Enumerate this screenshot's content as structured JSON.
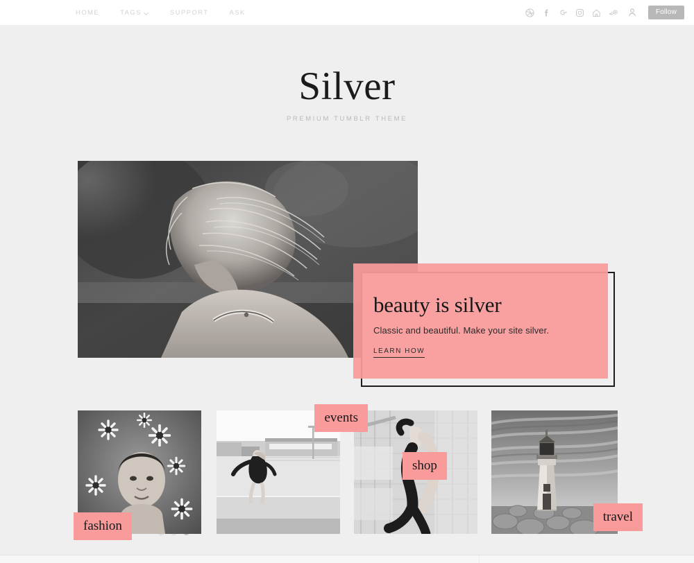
{
  "nav": {
    "items": [
      {
        "label": "HOME",
        "has_dropdown": false
      },
      {
        "label": "TAGS",
        "has_dropdown": true
      },
      {
        "label": "SUPPORT",
        "has_dropdown": false
      },
      {
        "label": "ASK",
        "has_dropdown": false
      }
    ],
    "social_icons": [
      "dribbble-icon",
      "facebook-icon",
      "google-plus-icon",
      "instagram-icon",
      "pinterest-icon",
      "twitter-icon"
    ],
    "account_icon": "user-avatar-icon",
    "follow_label": "Follow"
  },
  "header": {
    "title": "Silver",
    "subtitle": "PREMIUM TUMBLR THEME"
  },
  "hero": {
    "photo_alt": "black-and-white photo of woman with windswept hair",
    "heading": "beauty is silver",
    "subtext": "Classic and beautiful. Make your site silver.",
    "cta_label": "LEARN HOW",
    "dots": [
      {
        "active": false
      },
      {
        "active": false
      },
      {
        "active": true
      }
    ]
  },
  "categories": [
    {
      "label": "fashion",
      "photo_alt": "woman surrounded by daisies in water"
    },
    {
      "label": "events",
      "photo_alt": "woman dancing on an empty boardwalk"
    },
    {
      "label": "shop",
      "photo_alt": "woman posing by a metal fence"
    },
    {
      "label": "travel",
      "photo_alt": "lighthouse on rocks under dramatic sky"
    }
  ],
  "colors": {
    "accent_pink": "#FA9B9B",
    "page_background": "#EFEFEF",
    "nav_background": "#FFFFFF",
    "nav_link": "#D3D3D3",
    "follow_button": "#B8B8B8",
    "heading_text": "#1B1B1B"
  }
}
